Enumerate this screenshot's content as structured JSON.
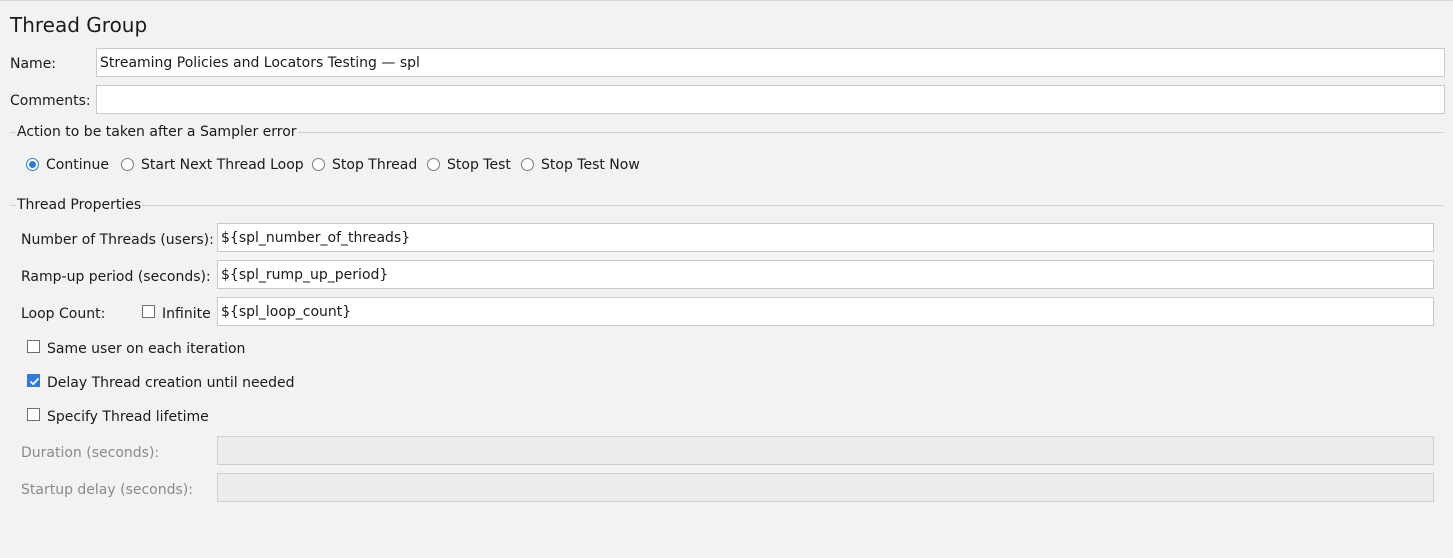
{
  "panel": {
    "title": "Thread Group"
  },
  "name_field": {
    "label": "Name:",
    "value": "Streaming Policies and Locators Testing — spl"
  },
  "comments_field": {
    "label": "Comments:",
    "value": ""
  },
  "sampler_error": {
    "section_title": "Action to be taken after a Sampler error",
    "options": [
      {
        "label": "Continue",
        "selected": true
      },
      {
        "label": "Start Next Thread Loop",
        "selected": false
      },
      {
        "label": "Stop Thread",
        "selected": false
      },
      {
        "label": "Stop Test",
        "selected": false
      },
      {
        "label": "Stop Test Now",
        "selected": false
      }
    ]
  },
  "thread_properties": {
    "section_title": "Thread Properties",
    "num_threads": {
      "label": "Number of Threads (users):",
      "value": "${spl_number_of_threads}"
    },
    "ramp_up": {
      "label": "Ramp-up period (seconds):",
      "value": "${spl_rump_up_period}"
    },
    "loop_count": {
      "label": "Loop Count:",
      "infinite_label": "Infinite",
      "infinite_checked": false,
      "value": "${spl_loop_count}"
    },
    "same_user": {
      "label": "Same user on each iteration",
      "checked": false
    },
    "delay_thread": {
      "label": "Delay Thread creation until needed",
      "checked": true
    },
    "specify_lifetime": {
      "label": "Specify Thread lifetime",
      "checked": false
    },
    "duration": {
      "label": "Duration (seconds):",
      "value": ""
    },
    "startup_delay": {
      "label": "Startup delay (seconds):",
      "value": ""
    }
  },
  "colors": {
    "background": "#f2f2f2",
    "accent": "#2f7bd6",
    "field_border": "#c9c9c9",
    "disabled_text": "#8a8a8a"
  }
}
